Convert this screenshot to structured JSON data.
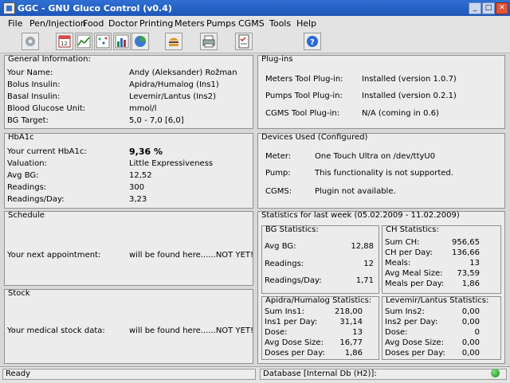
{
  "window": {
    "title": "GGC - GNU Gluco Control (v0.4)"
  },
  "menu": [
    "File",
    "Pen/Injection",
    "Food",
    "Doctor",
    "Printing",
    "Meters",
    "Pumps",
    "CGMS",
    "Tools",
    "Help"
  ],
  "toolbar_icons": [
    "settings-icon",
    "calendar-icon",
    "line-graph-icon",
    "spread-graph-icon",
    "bar-graph-icon",
    "pie-chart-icon",
    "food-icon",
    "printer-icon",
    "checklist-icon",
    "help-icon"
  ],
  "general": {
    "title": "General Information:",
    "rows": [
      {
        "label": "Your Name:",
        "value": "Andy (Aleksander) Rožman"
      },
      {
        "label": "Bolus Insulin:",
        "value": "Apidra/Humalog  (Ins1)"
      },
      {
        "label": "Basal Insulin:",
        "value": "Levemir/Lantus  (Ins2)"
      },
      {
        "label": "Blood Glucose Unit:",
        "value": "mmol/l"
      },
      {
        "label": "BG Target:",
        "value": "5,0 - 7,0 [6,0]"
      }
    ]
  },
  "plugins": {
    "title": "Plug-ins",
    "rows": [
      {
        "label": "Meters Tool Plug-in:",
        "value": "Installed (version 1.0.7)"
      },
      {
        "label": "Pumps Tool Plug-in:",
        "value": "Installed (version 0.2.1)"
      },
      {
        "label": "CGMS Tool Plug-in:",
        "value": "N/A (coming in 0.6)"
      }
    ]
  },
  "hba1c": {
    "title": "HbA1c",
    "rows": [
      {
        "label": "Your current HbA1c:",
        "value": "9,36 %"
      },
      {
        "label": "Valuation:",
        "value": "Little Expressiveness"
      },
      {
        "label": "Avg BG:",
        "value": "12,52"
      },
      {
        "label": "Readings:",
        "value": "300"
      },
      {
        "label": "Readings/Day:",
        "value": "3,23"
      }
    ]
  },
  "devices": {
    "title": "Devices Used (Configured)",
    "rows": [
      {
        "label": "Meter:",
        "value": "One Touch Ultra on /dev/ttyU0"
      },
      {
        "label": "Pump:",
        "value": "This functionality is not supported."
      },
      {
        "label": "CGMS:",
        "value": "Plugin not available."
      }
    ]
  },
  "schedule": {
    "title": "Schedule",
    "label": "Your next appointment:",
    "value": "will be found here......NOT YET!"
  },
  "stock": {
    "title": "Stock",
    "label": "Your medical stock data:",
    "value": "will be found here......NOT YET!"
  },
  "stats": {
    "title": "Statistics for last week (05.02.2009 - 11.02.2009)",
    "bg": {
      "title": "BG Statistics:",
      "rows": [
        {
          "label": "Avg BG:",
          "value": "12,88"
        },
        {
          "label": "Readings:",
          "value": "12"
        },
        {
          "label": "Readings/Day:",
          "value": "1,71"
        }
      ]
    },
    "ch": {
      "title": "CH Statistics:",
      "rows": [
        {
          "label": "Sum CH:",
          "value": "956,65"
        },
        {
          "label": "CH per Day:",
          "value": "136,66"
        },
        {
          "label": "Meals:",
          "value": "13"
        },
        {
          "label": "Avg Meal Size:",
          "value": "73,59"
        },
        {
          "label": "Meals per Day:",
          "value": "1,86"
        }
      ]
    },
    "ins1": {
      "title": "Apidra/Humalog Statistics:",
      "rows": [
        {
          "label": "Sum Ins1:",
          "value": "218,00"
        },
        {
          "label": "Ins1 per Day:",
          "value": "31,14"
        },
        {
          "label": "Dose:",
          "value": "13"
        },
        {
          "label": "Avg Dose Size:",
          "value": "16,77"
        },
        {
          "label": "Doses per Day:",
          "value": "1,86"
        }
      ]
    },
    "ins2": {
      "title": "Levemir/Lantus Statistics:",
      "rows": [
        {
          "label": "Sum Ins2:",
          "value": "0,00"
        },
        {
          "label": "Ins2 per Day:",
          "value": "0,00"
        },
        {
          "label": "Dose:",
          "value": "0"
        },
        {
          "label": "Avg Dose Size:",
          "value": "0,00"
        },
        {
          "label": "Doses per Day:",
          "value": "0,00"
        }
      ]
    }
  },
  "status": {
    "left": "Ready",
    "right": "Database [Internal Db (H2)]:"
  }
}
